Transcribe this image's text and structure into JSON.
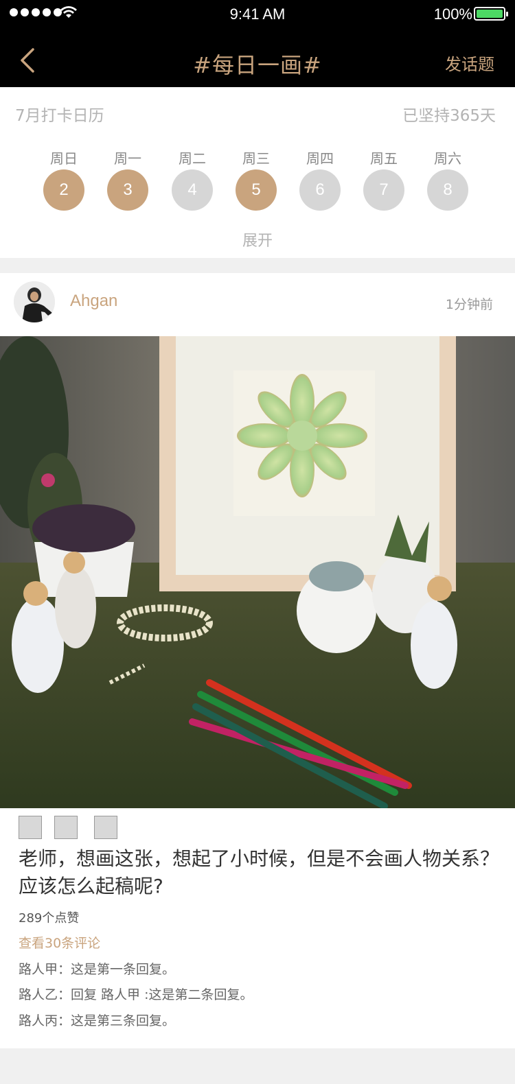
{
  "status_bar": {
    "time": "9:41 AM",
    "battery": "100%"
  },
  "nav": {
    "title": "#每日一画#",
    "post_topic_label": "发话题"
  },
  "calendar": {
    "month_label": "7月打卡日历",
    "streak_label": "已坚持365天",
    "expand_label": "展开",
    "days": [
      {
        "weekday": "周日",
        "date": "2",
        "checked": true
      },
      {
        "weekday": "周一",
        "date": "3",
        "checked": true
      },
      {
        "weekday": "周二",
        "date": "4",
        "checked": false
      },
      {
        "weekday": "周三",
        "date": "5",
        "checked": true
      },
      {
        "weekday": "周四",
        "date": "6",
        "checked": false
      },
      {
        "weekday": "周五",
        "date": "7",
        "checked": false
      },
      {
        "weekday": "周六",
        "date": "8",
        "checked": false
      }
    ]
  },
  "post": {
    "username": "Ahgan",
    "time_ago": "1分钟前",
    "caption": "老师，想画这张，想起了小时候，但是不会画人物关系？应该怎么起稿呢?",
    "likes": "289个点赞",
    "view_comments": "查看30条评论",
    "replies": [
      {
        "text": "路人甲：这是第一条回复。"
      },
      {
        "text": "路人乙：回复 路人甲 :这是第二条回复。"
      },
      {
        "text": "路人丙：这是第三条回复。"
      }
    ]
  },
  "colors": {
    "accent": "#c9a47e",
    "inactive_day": "#d6d6d6",
    "nav_bg": "#000000",
    "page_bg": "#f0f0f0"
  }
}
